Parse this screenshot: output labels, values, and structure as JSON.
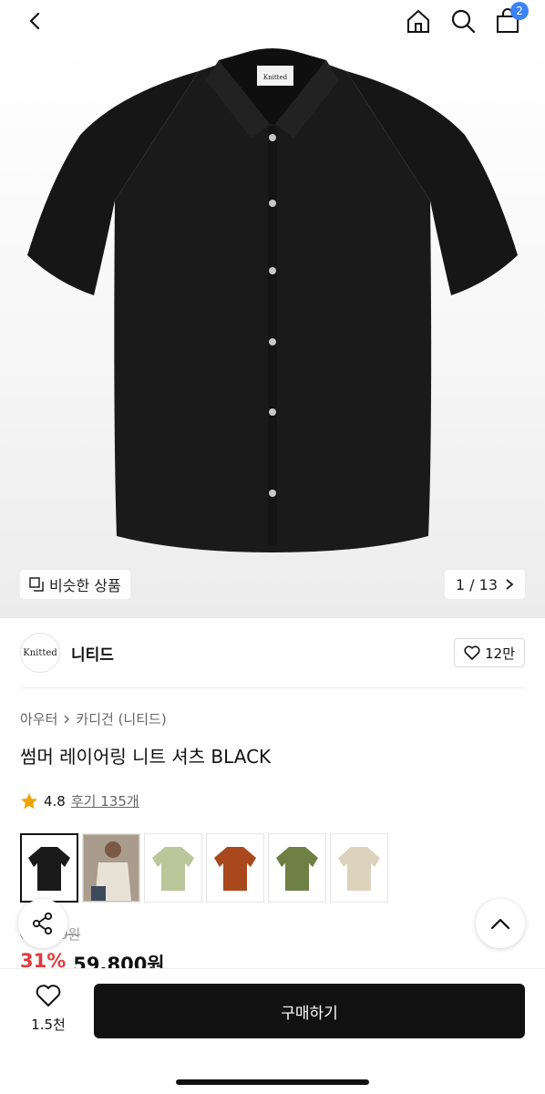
{
  "header": {
    "cart_count": "2"
  },
  "hero": {
    "shirt_label": "Knitted",
    "similar_label": "비슷한 상품",
    "counter": "1 / 13"
  },
  "brand": {
    "logo_text": "Knitted",
    "name": "니티드",
    "likes": "12만"
  },
  "breadcrumb": {
    "level1": "아우터",
    "level2": "카디건 (니티드)"
  },
  "product": {
    "title": "썸머 레이어링 니트 셔츠 BLACK",
    "rating": "4.8",
    "reviews": "후기 135개",
    "original_price": "86,800원",
    "discount": "31%",
    "price": "59,800원"
  },
  "colors": [
    {
      "name": "black",
      "hex": "#1a1a1a"
    },
    {
      "name": "model",
      "hex": "#d9d2c6"
    },
    {
      "name": "light-green",
      "hex": "#b9c79a"
    },
    {
      "name": "brown",
      "hex": "#a8481c"
    },
    {
      "name": "olive",
      "hex": "#6f8045"
    },
    {
      "name": "beige",
      "hex": "#ddd3bd"
    }
  ],
  "bottom": {
    "wish_count": "1.5천",
    "buy_label": "구매하기"
  },
  "icons": [
    "chevron-left-icon",
    "home-icon",
    "search-icon",
    "shopping-bag-icon",
    "copy-icon",
    "chevron-right-icon",
    "heart-icon",
    "star-icon",
    "share-icon",
    "chevron-up-icon"
  ],
  "accent": {
    "badge": "#3b82f6",
    "discount": "#e03b3b",
    "star": "#f0a400"
  }
}
